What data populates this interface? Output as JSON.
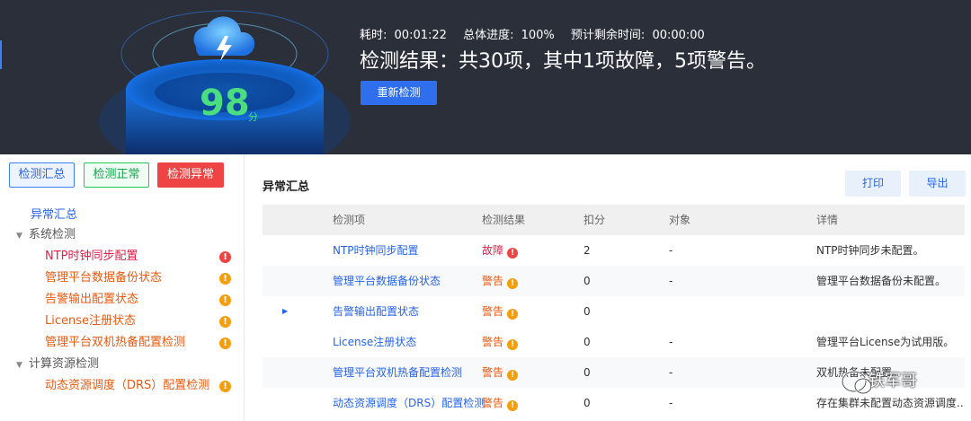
{
  "header": {
    "score": "98",
    "score_unit": "分",
    "elapsed_label": "耗时:",
    "elapsed_value": "00:01:22",
    "progress_label": "总体进度:",
    "progress_value": "100%",
    "remaining_label": "预计剩余时间:",
    "remaining_value": "00:00:00",
    "result_text": "检测结果：共30项，其中1项故障，5项警告。",
    "recheck_label": "重新检测"
  },
  "filters": {
    "summary": "检测汇总",
    "normal": "检测正常",
    "abnormal": "检测异常"
  },
  "tree": {
    "summary_link": "异常汇总",
    "group1": "系统检测",
    "items1": [
      {
        "label": "NTP时钟同步配置",
        "status": "fault"
      },
      {
        "label": "管理平台数据备份状态",
        "status": "warn"
      },
      {
        "label": "告警输出配置状态",
        "status": "warn"
      },
      {
        "label": "License注册状态",
        "status": "warn"
      },
      {
        "label": "管理平台双机热备配置检测",
        "status": "warn"
      }
    ],
    "group2": "计算资源检测",
    "items2": [
      {
        "label": "动态资源调度（DRS）配置检测",
        "status": "warn"
      }
    ]
  },
  "main": {
    "title": "异常汇总",
    "print_label": "打印",
    "export_label": "导出"
  },
  "table": {
    "headers": [
      "检测项",
      "检测结果",
      "扣分",
      "对象",
      "详情"
    ],
    "rows": [
      {
        "name": "NTP时钟同步配置",
        "result": "故障",
        "score": "2",
        "object": "-",
        "detail": "NTP时钟同步未配置。"
      },
      {
        "name": "管理平台数据备份状态",
        "result": "警告",
        "score": "0",
        "object": "-",
        "detail": "管理平台数据备份未配置。"
      },
      {
        "name": "告警输出配置状态",
        "result": "警告",
        "score": "0",
        "object": "",
        "detail": ""
      },
      {
        "name": "License注册状态",
        "result": "警告",
        "score": "0",
        "object": "-",
        "detail": "管理平台License为试用版。"
      },
      {
        "name": "管理平台双机热备配置检测",
        "result": "警告",
        "score": "0",
        "object": "-",
        "detail": "双机热备未配置。"
      },
      {
        "name": "动态资源调度（DRS）配置检测",
        "result": "警告",
        "score": "0",
        "object": "-",
        "detail": "存在集群未配置动态资源调度..."
      }
    ]
  },
  "watermark": "铁军哥",
  "colors": {
    "header_bg": "#2b2f3a",
    "accent": "#2f6fed",
    "fault": "#ef4444",
    "warn": "#f59e0b",
    "score_green": "#4ade80"
  }
}
